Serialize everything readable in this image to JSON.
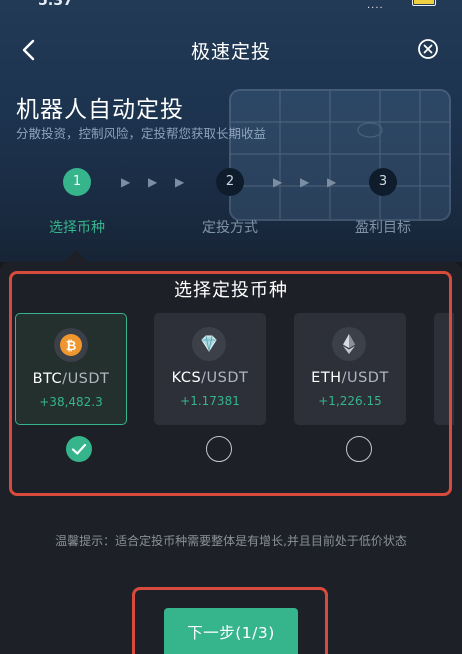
{
  "status_bar": {
    "time": "5:37",
    "signal": "....",
    "battery_color": "#f0d040"
  },
  "header": {
    "title": "极速定投",
    "back_icon": "chevron-left-icon",
    "close_icon": "close-circle-icon"
  },
  "hero": {
    "title": "机器人自动定投",
    "subtitle": "分散投资，控制风险，定投帮您获取长期收益"
  },
  "steps": [
    {
      "number": "1",
      "label": "选择币种",
      "active": true
    },
    {
      "number": "2",
      "label": "定投方式",
      "active": false
    },
    {
      "number": "3",
      "label": "盈利目标",
      "active": false
    }
  ],
  "section": {
    "title": "选择定投币种"
  },
  "coins": [
    {
      "base": "BTC",
      "separator": "/",
      "quote": "USDT",
      "change": "+38,482.3",
      "icon": "bitcoin-icon",
      "selected": true
    },
    {
      "base": "KCS",
      "separator": "/",
      "quote": "USDT",
      "change": "+1.17381",
      "icon": "kcs-diamond-icon",
      "selected": false
    },
    {
      "base": "ETH",
      "separator": "/",
      "quote": "USDT",
      "change": "+1,226.15",
      "icon": "ethereum-icon",
      "selected": false
    }
  ],
  "hint": "温馨提示：适合定投币种需要整体是有增长,并且目前处于低价状态",
  "next_button": {
    "label": "下一步(1/3)"
  },
  "colors": {
    "accent": "#36b48c",
    "highlight": "#d64b3c",
    "panel": "#1e2027",
    "card": "#2d3038"
  }
}
